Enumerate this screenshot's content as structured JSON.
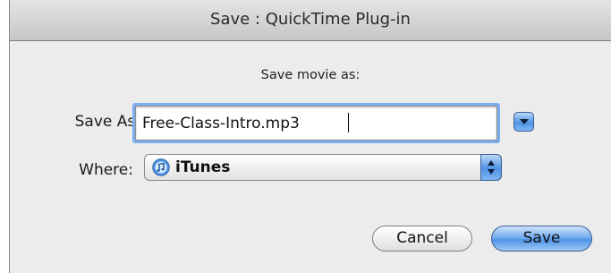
{
  "window": {
    "title": "Save : QuickTime Plug-in"
  },
  "dialog": {
    "prompt": "Save movie as:",
    "save_as_label": "Save As:",
    "filename": "Free-Class-Intro.mp3",
    "where_label": "Where:",
    "where_value": "iTunes",
    "where_icon": "itunes-icon",
    "expand_icon": "disclosure-triangle-icon"
  },
  "buttons": {
    "cancel_label": "Cancel",
    "save_label": "Save"
  },
  "colors": {
    "accent": "#4f93e6",
    "focus_ring": "#7aaef0"
  }
}
